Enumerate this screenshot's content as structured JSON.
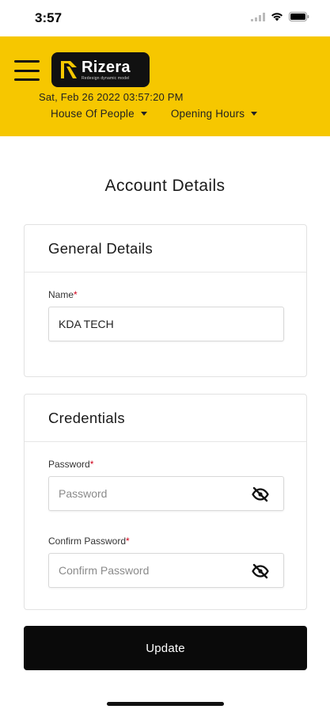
{
  "status_bar": {
    "time": "3:57"
  },
  "header": {
    "logo_name": "Rizera",
    "logo_tagline": "Redesign dynamic model",
    "datetime": "Sat, Feb 26 2022  03:57:20 PM",
    "location_dropdown": "House Of People",
    "hours_dropdown": "Opening Hours"
  },
  "page": {
    "title": "Account Details"
  },
  "general_details": {
    "title": "General Details",
    "name_label": "Name",
    "name_value": "KDA TECH"
  },
  "credentials": {
    "title": "Credentials",
    "password_label": "Password",
    "password_placeholder": "Password",
    "confirm_label": "Confirm Password",
    "confirm_placeholder": "Confirm Password"
  },
  "required_marker": "*",
  "actions": {
    "update_label": "Update"
  },
  "colors": {
    "header_bg": "#f6c700",
    "button_bg": "#0a0a0a",
    "required": "#d0021b"
  },
  "icons": [
    "signal-icon",
    "wifi-icon",
    "battery-icon",
    "menu-icon",
    "rizera-logo-icon",
    "caret-down-icon",
    "eye-off-icon"
  ]
}
